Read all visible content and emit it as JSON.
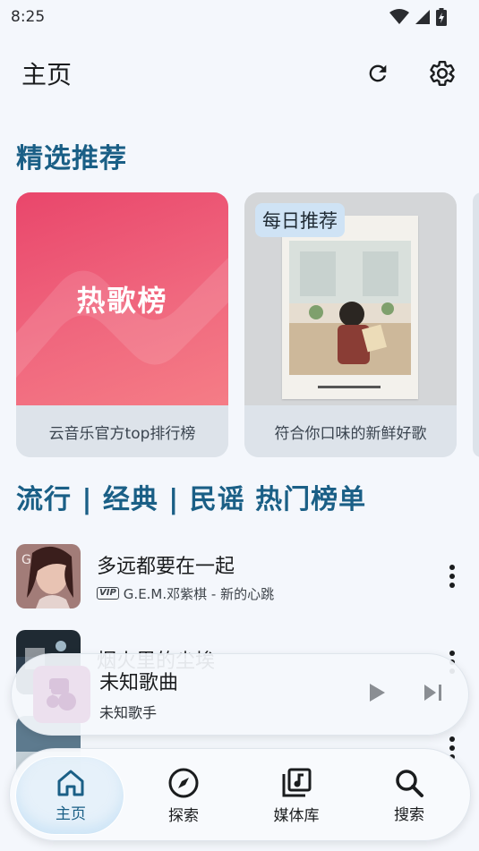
{
  "status": {
    "time": "8:25"
  },
  "header": {
    "title": "主页"
  },
  "featured": {
    "title": "精选推荐",
    "cards": [
      {
        "image_label": "热歌榜",
        "caption": "云音乐官方top排行榜"
      },
      {
        "badge": "每日推荐",
        "caption": "符合你口味的新鲜好歌"
      }
    ]
  },
  "charts_section": {
    "title": "流行 | 经典 | 民谣 热门榜单"
  },
  "songs": [
    {
      "title": "多远都要在一起",
      "vip": "VIP",
      "subtitle": "G.E.M.邓紫棋 - 新的心跳"
    },
    {
      "title": "烟火里的尘埃",
      "subtitle": ""
    }
  ],
  "mini_player": {
    "title": "未知歌曲",
    "artist": "未知歌手"
  },
  "nav": {
    "items": [
      {
        "label": "主页",
        "icon": "home-icon",
        "active": true
      },
      {
        "label": "探索",
        "icon": "compass-icon"
      },
      {
        "label": "媒体库",
        "icon": "library-icon"
      },
      {
        "label": "搜索",
        "icon": "search-icon"
      }
    ]
  },
  "colors": {
    "accent": "#1a5f86",
    "background": "#f4f7fc",
    "hot_gradient_start": "#e9466b"
  }
}
